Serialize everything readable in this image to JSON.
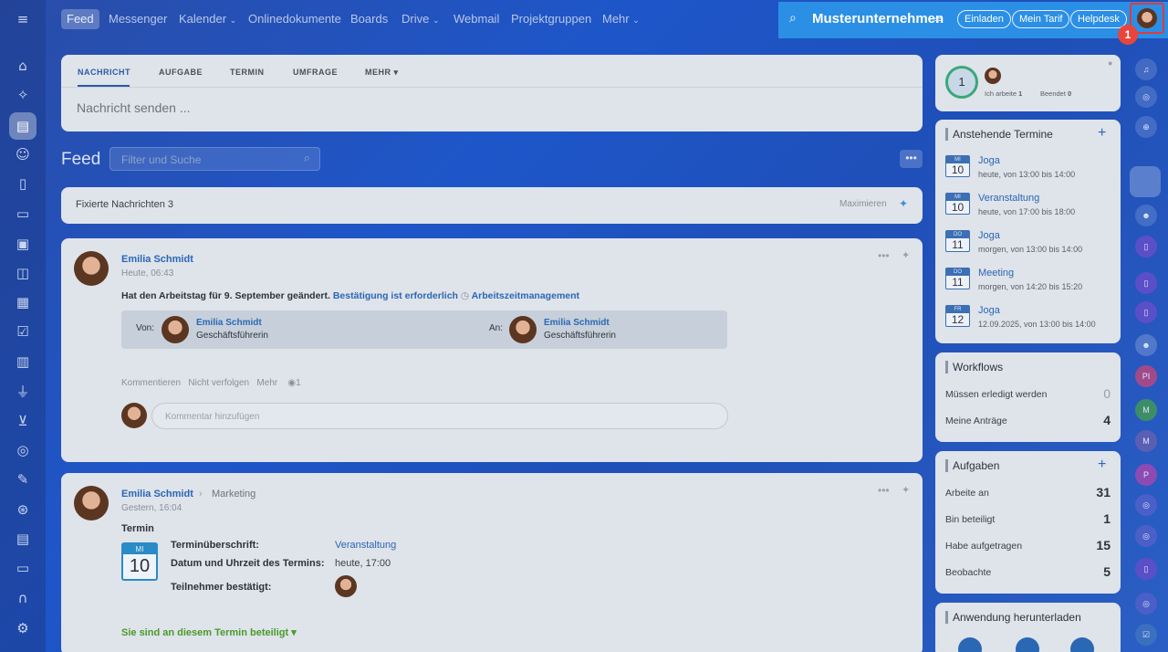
{
  "topnav": {
    "items": [
      "Feed",
      "Messenger",
      "Kalender",
      "Onlinedokumente",
      "Boards",
      "Drive",
      "Webmail",
      "Projektgruppen",
      "Mehr"
    ]
  },
  "topbar": {
    "company": "Musterunternehmen",
    "invite": "Einladen",
    "plan": "Mein Tarif",
    "helpdesk": "Helpdesk",
    "badge": "1"
  },
  "composer": {
    "tabs": [
      "NACHRICHT",
      "AUFGABE",
      "TERMIN",
      "UMFRAGE",
      "MEHR"
    ],
    "placeholder": "Nachricht senden ..."
  },
  "feed": {
    "title": "Feed",
    "filter_placeholder": "Filter und Suche",
    "pinned_label": "Fixierte Nachrichten 3",
    "maximize": "Maximieren"
  },
  "post1": {
    "author": "Emilia Schmidt",
    "time": "Heute, 06:43",
    "text": "Hat den Arbeitstag für 9. September geändert.",
    "confirm": "Bestätigung ist erforderlich",
    "module": "Arbeitszeitmanagement",
    "from_label": "Von:",
    "from_name": "Emilia Schmidt",
    "from_role": "Geschäftsführerin",
    "to_label": "An:",
    "to_name": "Emilia Schmidt",
    "to_role": "Geschäftsführerin",
    "action_comment": "Kommentieren",
    "action_unfollow": "Nicht verfolgen",
    "action_more": "Mehr",
    "views": "1",
    "comment_placeholder": "Kommentar hinzufügen"
  },
  "post2": {
    "author": "Emilia Schmidt",
    "group": "Marketing",
    "time": "Gestern, 16:04",
    "type": "Termin",
    "cal_day": "MI",
    "cal_date": "10",
    "f1_label": "Terminüberschrift:",
    "f1_value": "Veranstaltung",
    "f2_label": "Datum und Uhrzeit des Termins:",
    "f2_value": "heute, 17:00",
    "f3_label": "Teilnehmer bestätigt:",
    "participation": "Sie sind an diesem Termin beteiligt"
  },
  "worktime": {
    "count": "1",
    "working_label": "Ich arbeite",
    "working_value": "1",
    "done_label": "Beendet",
    "done_value": "0"
  },
  "events": {
    "title": "Anstehende Termine",
    "items": [
      {
        "day": "MI",
        "date": "10",
        "name": "Joga",
        "when": "heute, von 13:00 bis 14:00"
      },
      {
        "day": "MI",
        "date": "10",
        "name": "Veranstaltung",
        "when": "heute, von 17:00 bis 18:00"
      },
      {
        "day": "DO",
        "date": "11",
        "name": "Joga",
        "when": "morgen, von 13:00 bis 14:00"
      },
      {
        "day": "DO",
        "date": "11",
        "name": "Meeting",
        "when": "morgen, von 14:20 bis 15:20"
      },
      {
        "day": "FR",
        "date": "12",
        "name": "Joga",
        "when": "12.09.2025, von 13:00 bis 14:00"
      }
    ]
  },
  "workflows": {
    "title": "Workflows",
    "rows": [
      {
        "label": "Müssen erledigt werden",
        "value": "0"
      },
      {
        "label": "Meine Anträge",
        "value": "4"
      }
    ]
  },
  "tasks": {
    "title": "Aufgaben",
    "rows": [
      {
        "label": "Arbeite an",
        "value": "31"
      },
      {
        "label": "Bin beteiligt",
        "value": "1"
      },
      {
        "label": "Habe aufgetragen",
        "value": "15"
      },
      {
        "label": "Beobachte",
        "value": "5"
      }
    ]
  },
  "download": {
    "title": "Anwendung herunterladen"
  },
  "rail": [
    "PI",
    "M",
    "M",
    "P"
  ]
}
